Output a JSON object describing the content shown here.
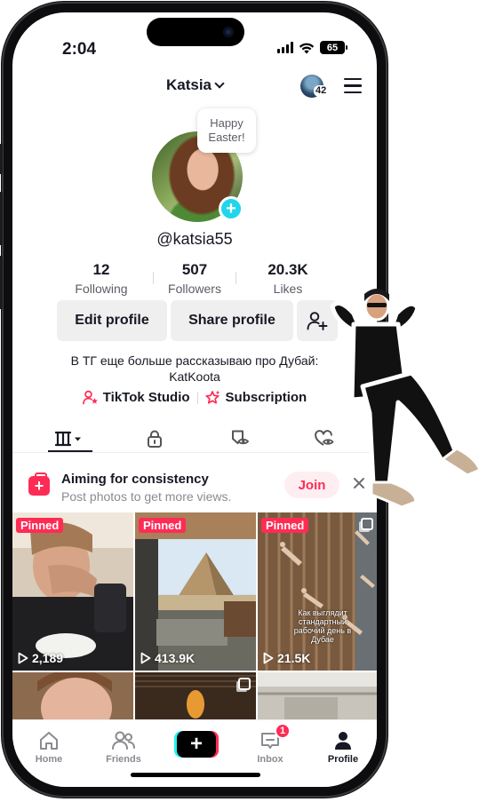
{
  "status_bar": {
    "time": "2:04",
    "battery": "65"
  },
  "header": {
    "username_title": "Katsia",
    "notifications_count": "42"
  },
  "profile": {
    "bubble_text_line1": "Happy",
    "bubble_text_line2": "Easter!",
    "handle": "@katsia55",
    "stats": [
      {
        "value": "12",
        "label": "Following"
      },
      {
        "value": "507",
        "label": "Followers"
      },
      {
        "value": "20.3K",
        "label": "Likes"
      }
    ],
    "buttons": {
      "edit": "Edit profile",
      "share": "Share profile"
    },
    "bio_line1": "В ТГ еще больше рассказываю про Дубай:",
    "bio_line2": "KatKoota",
    "links": {
      "studio": "TikTok Studio",
      "subscription": "Subscription"
    }
  },
  "tabs": [
    "videos-grid-icon",
    "lock-icon",
    "bookmark-eye-icon",
    "heart-eye-icon"
  ],
  "banner": {
    "title": "Aiming for consistency",
    "subtitle": "Post photos to get more views.",
    "join_label": "Join"
  },
  "videos": [
    {
      "pinned": "Pinned",
      "views": "2,189"
    },
    {
      "pinned": "Pinned",
      "views": "413.9K"
    },
    {
      "pinned": "Pinned",
      "views": "21.5K",
      "caption": "Как выглядит стандартный рабочий день в Дубае"
    },
    {
      "pinned": "",
      "views": ""
    },
    {
      "pinned": "",
      "views": ""
    },
    {
      "pinned": "",
      "views": ""
    }
  ],
  "nav": {
    "home": "Home",
    "friends": "Friends",
    "inbox": "Inbox",
    "inbox_badge": "1",
    "profile": "Profile"
  },
  "colors": {
    "accent_red": "#fe2c55",
    "accent_cyan": "#20d5ec",
    "text_primary": "#161823",
    "text_secondary": "#8a8b91"
  }
}
